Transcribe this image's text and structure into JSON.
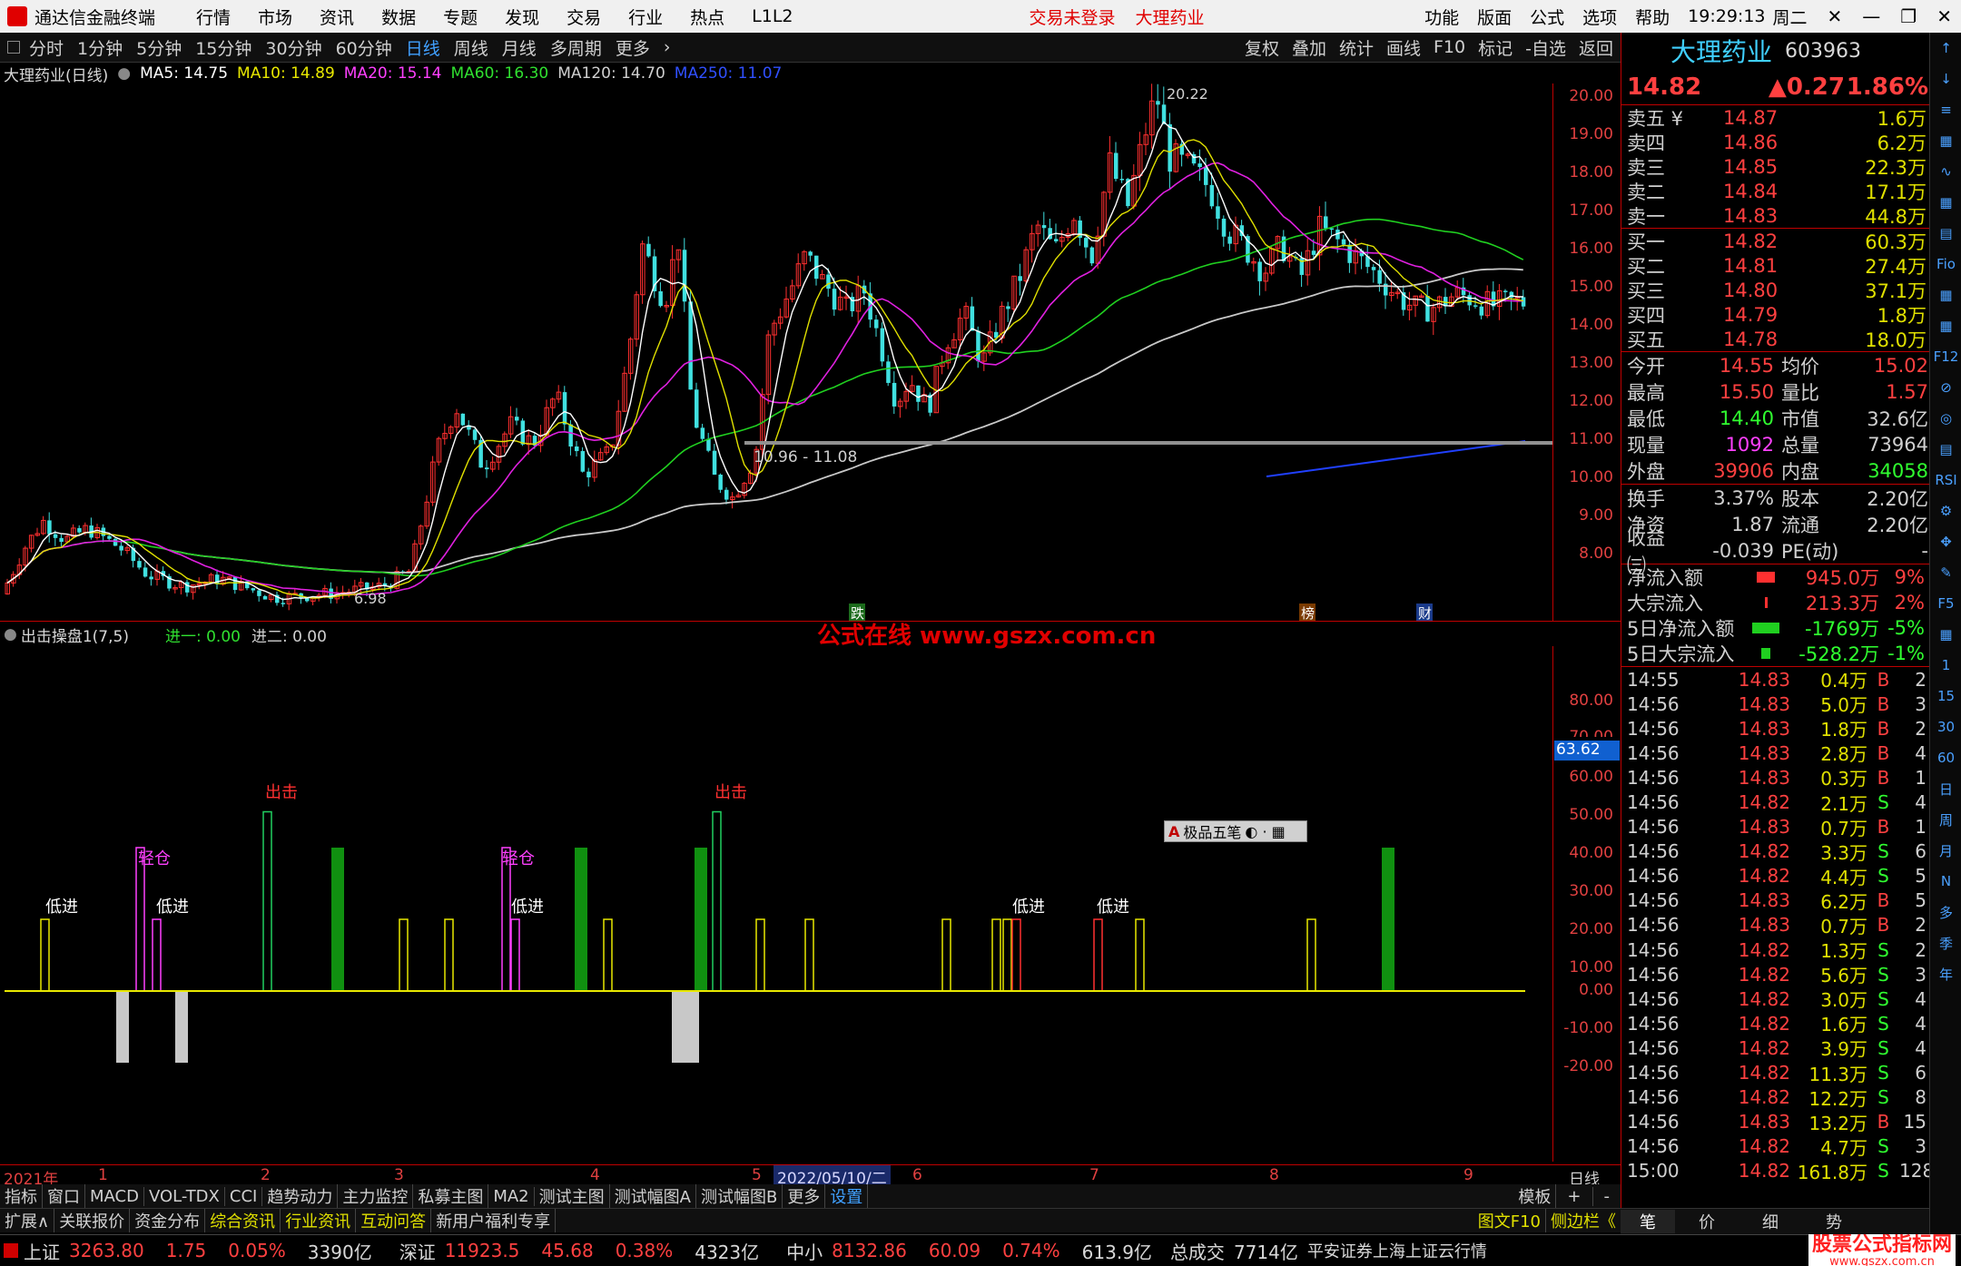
{
  "titlebar": {
    "app": "通达信金融终端",
    "menu": [
      "行情",
      "市场",
      "资讯",
      "数据",
      "专题",
      "发现",
      "交易",
      "行业",
      "热点",
      "L1L2"
    ],
    "login": "交易未登录",
    "stock": "大理药业",
    "right": [
      "功能",
      "版面",
      "公式",
      "选项",
      "帮助"
    ],
    "time": "19:29:13",
    "weekday": "周二"
  },
  "toolbar": {
    "tabs": [
      "分时",
      "1分钟",
      "5分钟",
      "15分钟",
      "30分钟",
      "60分钟",
      "日线",
      "周线",
      "月线",
      "多周期",
      "更多"
    ],
    "tools": [
      "复权",
      "叠加",
      "统计",
      "画线",
      "F10",
      "标记",
      "-自选",
      "返回"
    ]
  },
  "ma": {
    "name": "大理药业(日线)",
    "ma5": "MA5: 14.75",
    "ma10": "MA10: 14.89",
    "ma20": "MA20: 15.14",
    "ma60": "MA60: 16.30",
    "ma120": "MA120: 14.70",
    "ma250": "MA250: 11.07"
  },
  "priceaxis": [
    "20.00",
    "19.00",
    "18.00",
    "17.00",
    "16.00",
    "15.00",
    "14.00",
    "13.00",
    "12.00",
    "11.00",
    "10.00",
    "9.00",
    "8.00"
  ],
  "chartlabels": {
    "high": "20.22",
    "low": "6.98",
    "range": "10.96 - 11.08",
    "m1": "跌",
    "m2": "榜",
    "m3": "财"
  },
  "indicator": {
    "name": "出击操盘1(7,5)",
    "in1": "进一: 0.00",
    "in2": "进二: 0.00",
    "tag": "63.62",
    "signals": {
      "low": "低进",
      "light": "轻仓",
      "hit": "出击"
    }
  },
  "indaxis": [
    "80.00",
    "70.00",
    "60.00",
    "50.00",
    "40.00",
    "30.00",
    "20.00",
    "10.00",
    "0.00",
    "-10.00",
    "-20.00"
  ],
  "watermark": "公式在线 www.gszx.com.cn",
  "floatbox": "极品五笔",
  "xaxis": {
    "labels": [
      "2021年",
      "1",
      "2",
      "3",
      "4",
      "5",
      "6",
      "7",
      "8",
      "9"
    ],
    "date": "2022/05/10/二",
    "period": "日线"
  },
  "bottabs": [
    "指标",
    "窗口",
    "MACD",
    "VOL-TDX",
    "CCI",
    "趋势动力",
    "主力监控",
    "私募主图",
    "MA2",
    "测试主图",
    "测试幅图A",
    "测试幅图B",
    "更多",
    "设置"
  ],
  "bottabs_right": [
    "模板",
    "+",
    "-"
  ],
  "infobar": [
    "扩展∧",
    "关联报价",
    "资金分布",
    "综合资讯",
    "行业资讯",
    "互动问答",
    "新用户福利专享"
  ],
  "infobar_right": [
    "图文F10",
    "侧边栏《"
  ],
  "status": {
    "sh_name": "上证",
    "sh": "3263.80",
    "sh_chg": "1.75",
    "sh_pct": "0.05%",
    "sh_amt": "3390亿",
    "sz_name": "深证",
    "sz": "11923.5",
    "sz_chg": "45.68",
    "sz_pct": "0.38%",
    "sz_amt": "4323亿",
    "zx_name": "中小",
    "zx": "8132.86",
    "zx_chg": "60.09",
    "zx_pct": "0.74%",
    "zx_amt": "613.9亿",
    "total_label": "总成交",
    "total": "7714亿",
    "broker": "平安证券上海上证云行情",
    "brand": "股票公式指标网",
    "brand_url": "www.gszx.com.cn"
  },
  "stock": {
    "name": "大理药业",
    "code": "603963",
    "price": "14.82",
    "chg": "▲0.27",
    "pct": "1.86%"
  },
  "asks": [
    {
      "l": "卖五 ¥",
      "p": "14.87",
      "v": "1.6万"
    },
    {
      "l": "卖四",
      "p": "14.86",
      "v": "6.2万"
    },
    {
      "l": "卖三",
      "p": "14.85",
      "v": "22.3万"
    },
    {
      "l": "卖二",
      "p": "14.84",
      "v": "17.1万"
    },
    {
      "l": "卖一",
      "p": "14.83",
      "v": "44.8万"
    }
  ],
  "bids": [
    {
      "l": "买一",
      "p": "14.82",
      "v": "60.3万"
    },
    {
      "l": "买二",
      "p": "14.81",
      "v": "27.4万"
    },
    {
      "l": "买三",
      "p": "14.80",
      "v": "37.1万"
    },
    {
      "l": "买四",
      "p": "14.79",
      "v": "1.8万"
    },
    {
      "l": "买五",
      "p": "14.78",
      "v": "18.0万"
    }
  ],
  "stats": [
    {
      "a": "今开",
      "b": "14.55",
      "bc": "#ff4040",
      "c": "均价",
      "d": "15.02",
      "dc": "#ff4040"
    },
    {
      "a": "最高",
      "b": "15.50",
      "bc": "#ff4040",
      "c": "量比",
      "d": "1.57",
      "dc": "#ff4040"
    },
    {
      "a": "最低",
      "b": "14.40",
      "bc": "#30ff30",
      "c": "市值",
      "d": "32.6亿",
      "dc": "#d0d0d0"
    },
    {
      "a": "现量",
      "b": "1092",
      "bc": "#ff40ff",
      "c": "总量",
      "d": "73964",
      "dc": "#d0d0d0"
    },
    {
      "a": "外盘",
      "b": "39906",
      "bc": "#ff4040",
      "c": "内盘",
      "d": "34058",
      "dc": "#30ff30"
    }
  ],
  "stats2": [
    {
      "a": "换手",
      "b": "3.37%",
      "bc": "#d0d0d0",
      "c": "股本",
      "d": "2.20亿",
      "dc": "#d0d0d0"
    },
    {
      "a": "净资",
      "b": "1.87",
      "bc": "#d0d0d0",
      "c": "流通",
      "d": "2.20亿",
      "dc": "#d0d0d0"
    },
    {
      "a": "收益㈢",
      "b": "-0.039",
      "bc": "#d0d0d0",
      "c": "PE(动)",
      "d": "-",
      "dc": "#d0d0d0"
    }
  ],
  "moneyflow": [
    {
      "k": "净流入额",
      "bar": "#ff3030",
      "bw": "20px",
      "val": "945.0万",
      "vc": "#ff4040",
      "pct": "9%",
      "pc": "#ff4040"
    },
    {
      "k": "大宗流入",
      "bar": "#ff3030",
      "bw": "3px",
      "val": "213.3万",
      "vc": "#ff4040",
      "pct": "2%",
      "pc": "#ff4040"
    },
    {
      "k": "5日净流入额",
      "bar": "#20d020",
      "bw": "34px",
      "val": "-1769万",
      "vc": "#30ff30",
      "pct": "-5%",
      "pc": "#30ff30"
    },
    {
      "k": "5日大宗流入",
      "bar": "#20d020",
      "bw": "10px",
      "val": "-528.2万",
      "vc": "#30ff30",
      "pct": "-1%",
      "pc": "#30ff30"
    }
  ],
  "ticks": [
    [
      "14:55",
      "14.83",
      "0.4万",
      "B",
      "2"
    ],
    [
      "14:56",
      "14.83",
      "5.0万",
      "B",
      "3"
    ],
    [
      "14:56",
      "14.83",
      "1.8万",
      "B",
      "2"
    ],
    [
      "14:56",
      "14.83",
      "2.8万",
      "B",
      "4"
    ],
    [
      "14:56",
      "14.83",
      "0.3万",
      "B",
      "1"
    ],
    [
      "14:56",
      "14.82",
      "2.1万",
      "S",
      "4"
    ],
    [
      "14:56",
      "14.83",
      "0.7万",
      "B",
      "1"
    ],
    [
      "14:56",
      "14.82",
      "3.3万",
      "S",
      "6"
    ],
    [
      "14:56",
      "14.82",
      "4.4万",
      "S",
      "5"
    ],
    [
      "14:56",
      "14.83",
      "6.2万",
      "B",
      "5"
    ],
    [
      "14:56",
      "14.83",
      "0.7万",
      "B",
      "2"
    ],
    [
      "14:56",
      "14.82",
      "1.3万",
      "S",
      "2"
    ],
    [
      "14:56",
      "14.82",
      "5.6万",
      "S",
      "3"
    ],
    [
      "14:56",
      "14.82",
      "3.0万",
      "S",
      "4"
    ],
    [
      "14:56",
      "14.82",
      "1.6万",
      "S",
      "4"
    ],
    [
      "14:56",
      "14.82",
      "3.9万",
      "S",
      "4"
    ],
    [
      "14:56",
      "14.82",
      "11.3万",
      "S",
      "6"
    ],
    [
      "14:56",
      "14.82",
      "12.2万",
      "S",
      "8"
    ],
    [
      "14:56",
      "14.83",
      "13.2万",
      "B",
      "15"
    ],
    [
      "14:56",
      "14.82",
      "4.7万",
      "S",
      "3"
    ],
    [
      "15:00",
      "14.82",
      "161.8万",
      "S",
      "128"
    ]
  ],
  "rpbottom": [
    "笔",
    "价",
    "细",
    "势"
  ],
  "ricons": [
    "↑",
    "↓",
    "≡",
    "▦",
    "∿",
    "▦",
    "▤",
    "Fio",
    "▦",
    "▦",
    "F12",
    "⊘",
    "◎",
    "▤",
    "RSI",
    "⚙",
    "✥",
    "✎",
    "F5",
    "▦",
    "1",
    "15",
    "30",
    "60",
    "日",
    "周",
    "月",
    "N",
    "多",
    "季",
    "年"
  ]
}
